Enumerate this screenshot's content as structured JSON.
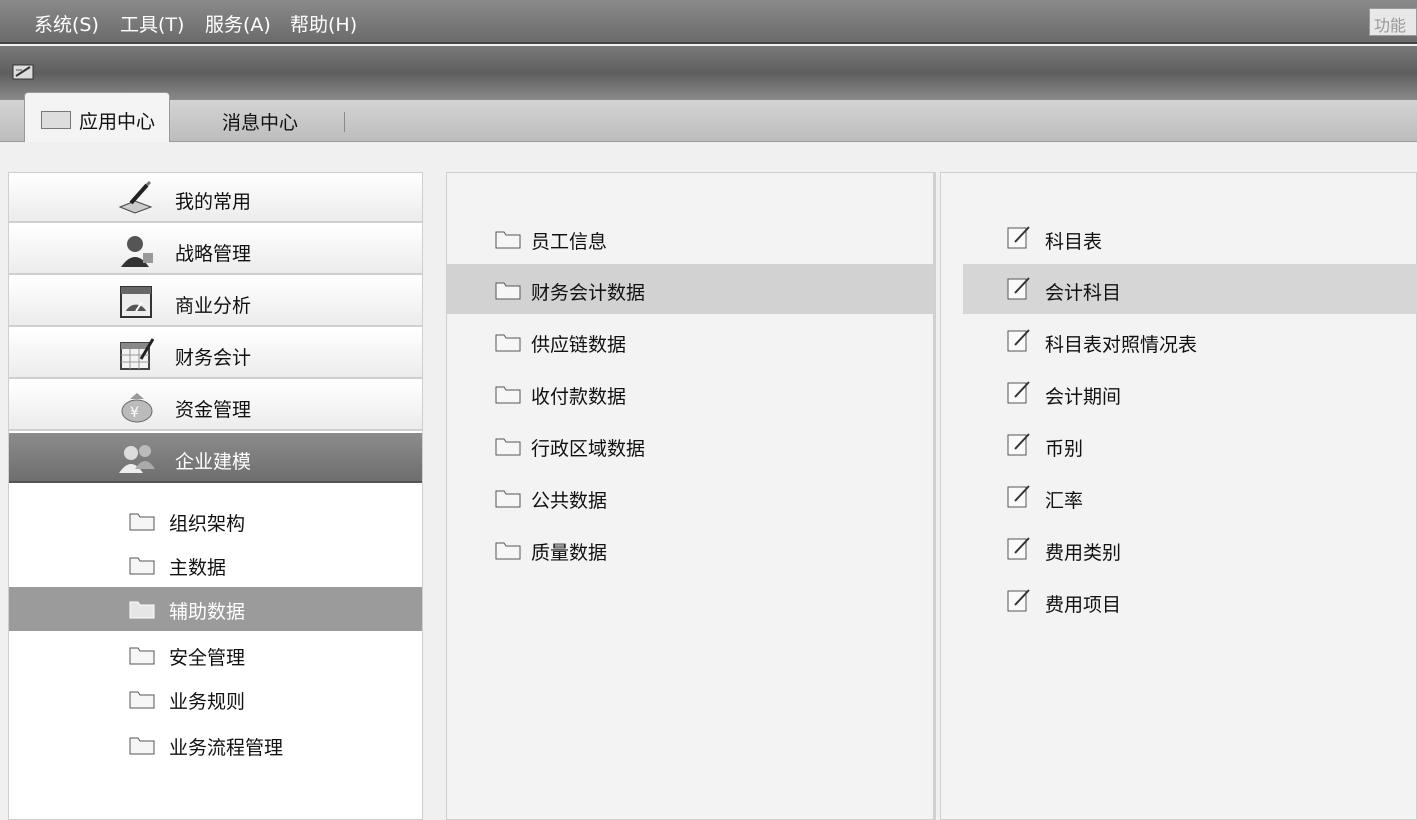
{
  "menu": {
    "items": [
      "系统(S)",
      "工具(T)",
      "服务(A)",
      "帮助(H)"
    ],
    "function_box": "功能"
  },
  "tabs": [
    {
      "label": "应用中心"
    },
    {
      "label": "消息中心"
    }
  ],
  "accordion": [
    {
      "label": "我的常用",
      "icon": "pen-book-icon"
    },
    {
      "label": "战略管理",
      "icon": "person-icon"
    },
    {
      "label": "商业分析",
      "icon": "dashboard-icon"
    },
    {
      "label": "财务会计",
      "icon": "calendar-icon"
    },
    {
      "label": "资金管理",
      "icon": "money-bag-icon"
    },
    {
      "label": "企业建模",
      "icon": "people-icon"
    }
  ],
  "submenu": [
    {
      "label": "组织架构"
    },
    {
      "label": "主数据"
    },
    {
      "label": "辅助数据"
    },
    {
      "label": "安全管理"
    },
    {
      "label": "业务规则"
    },
    {
      "label": "业务流程管理"
    }
  ],
  "middle": [
    {
      "label": "员工信息"
    },
    {
      "label": "财务会计数据"
    },
    {
      "label": "供应链数据"
    },
    {
      "label": "收付款数据"
    },
    {
      "label": "行政区域数据"
    },
    {
      "label": "公共数据"
    },
    {
      "label": "质量数据"
    }
  ],
  "right": [
    {
      "label": "科目表"
    },
    {
      "label": "会计科目"
    },
    {
      "label": "科目表对照情况表"
    },
    {
      "label": "会计期间"
    },
    {
      "label": "币别"
    },
    {
      "label": "汇率"
    },
    {
      "label": "费用类别"
    },
    {
      "label": "费用项目"
    }
  ]
}
